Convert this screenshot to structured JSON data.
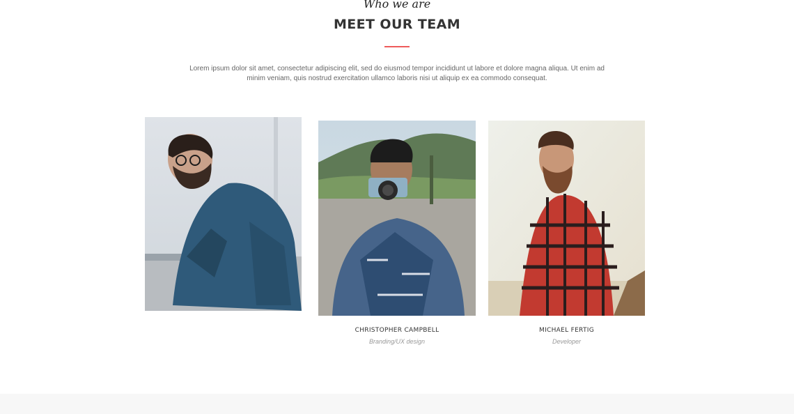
{
  "section": {
    "tagline": "Who we are",
    "title": "MEET OUR TEAM",
    "intro": "Lorem ipsum dolor sit amet, consectetur adipiscing elit, sed do eiusmod tempor incididunt ut labore et dolore magna aliqua. Ut enim ad minim veniam, quis nostrud exercitation ullamco laboris nisi ut aliquip ex ea commodo consequat."
  },
  "team": [
    {
      "name": "",
      "role": "",
      "photo": "man-with-glasses-denim-shirt-photo"
    },
    {
      "name": "CHRISTOPHER CAMPBELL",
      "role": "Branding/UX design",
      "photo": "man-with-camera-plaid-shirt-photo"
    },
    {
      "name": "MICHAEL FERTIG",
      "role": "Developer",
      "photo": "bearded-man-red-plaid-shirt-photo"
    }
  ],
  "colors": {
    "accent": "#ee5a5a",
    "heading": "#333333",
    "body_text": "#666666",
    "muted_text": "#999999",
    "footer_band": "#f7f7f7"
  }
}
